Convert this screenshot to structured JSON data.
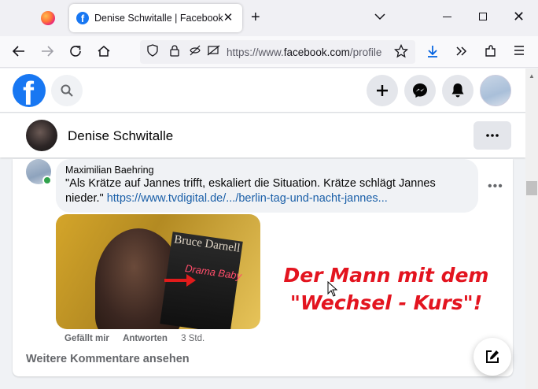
{
  "browser": {
    "tab_title": "Denise Schwitalle | Facebook",
    "tab_favicon": "f",
    "url_prefix": "https://www.",
    "url_domain": "facebook.com",
    "url_suffix": "/profile"
  },
  "profile": {
    "name": "Denise Schwitalle"
  },
  "comment": {
    "author": "Maximilian Baehring",
    "text": "\"Als Krätze auf Jannes trifft, eskaliert die Situation. Krätze schlägt Jannes nieder.\"",
    "link": "https://www.tvdigital.de/.../berlin-tag-und-nacht-jannes...",
    "photo_book_title": "Bruce Darnell",
    "photo_book_sub": "Drama Baby",
    "overlay_line1": "Der Mann mit dem",
    "overlay_line2": "\"Wechsel - Kurs\"!",
    "like_label": "Gefällt mir",
    "reply_label": "Antworten",
    "time": "3 Std."
  },
  "feed": {
    "more_comments": "Weitere Kommentare ansehen"
  },
  "colors": {
    "fb_blue": "#1877f2",
    "link_blue": "#1a5fa8",
    "overlay_red": "#e3141f",
    "online_green": "#31a24c"
  }
}
